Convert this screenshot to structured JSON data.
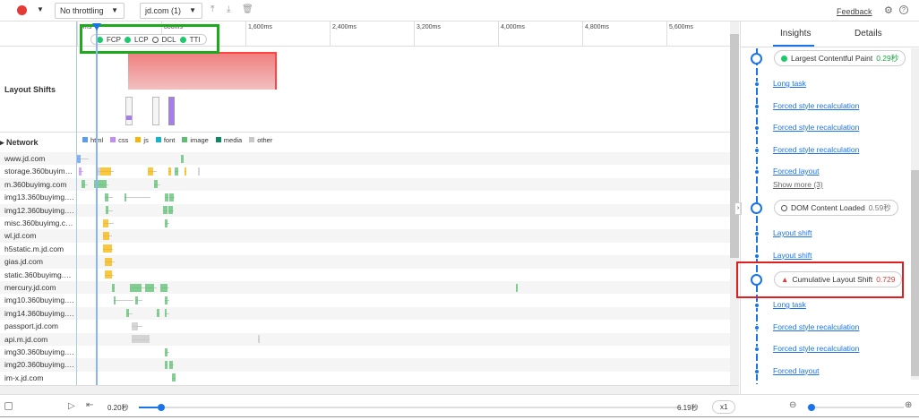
{
  "toolbar": {
    "throttling": "No throttling",
    "profile": "jd.com (1)",
    "feedback": "Feedback"
  },
  "ruler": {
    "ticks": [
      "0ms",
      "800ms",
      "1,600ms",
      "2,400ms",
      "3,200ms",
      "4,000ms",
      "4,800ms",
      "5,600ms"
    ]
  },
  "metrics_legend": [
    "FCP",
    "LCP",
    "DCL",
    "TTI"
  ],
  "layout_shifts": {
    "label": "Layout Shifts"
  },
  "network": {
    "label": "Network",
    "legend": [
      {
        "name": "html",
        "color": "#5b9cf0"
      },
      {
        "name": "css",
        "color": "#c58af9"
      },
      {
        "name": "js",
        "color": "#f7b500"
      },
      {
        "name": "font",
        "color": "#12b5cb"
      },
      {
        "name": "image",
        "color": "#5bbf6f"
      },
      {
        "name": "media",
        "color": "#0d8a5c"
      },
      {
        "name": "other",
        "color": "#c8c8c8"
      }
    ],
    "rows": [
      {
        "host": "www.jd.com",
        "segs": [
          [
            "html",
            0,
            30,
            110
          ],
          [
            "image",
            990,
            1010,
            1010
          ]
        ]
      },
      {
        "host": "storage.360buyimg.com",
        "segs": [
          [
            "css",
            20,
            40,
            60
          ],
          [
            "other",
            180,
            220,
            220
          ],
          [
            "js",
            220,
            320,
            350
          ],
          [
            "js",
            670,
            720,
            760
          ],
          [
            "js",
            870,
            890,
            890
          ],
          [
            "image",
            930,
            960,
            960
          ],
          [
            "js",
            1020,
            1040,
            1040
          ],
          [
            "other",
            1150,
            1160,
            1160
          ]
        ]
      },
      {
        "host": "m.360buyimg.com",
        "segs": [
          [
            "image",
            40,
            80,
            100
          ],
          [
            "image",
            160,
            280,
            300
          ],
          [
            "image",
            730,
            770,
            790
          ]
        ]
      },
      {
        "host": "img13.360buyimg.com",
        "segs": [
          [
            "image",
            260,
            300,
            340
          ],
          [
            "image",
            450,
            470,
            700
          ],
          [
            "image",
            830,
            870,
            870
          ],
          [
            "image",
            880,
            920,
            930
          ]
        ]
      },
      {
        "host": "img12.360buyimg.com",
        "segs": [
          [
            "image",
            270,
            300,
            340
          ],
          [
            "image",
            820,
            860,
            860
          ],
          [
            "image",
            870,
            910,
            920
          ]
        ]
      },
      {
        "host": "misc.360buyimg.com",
        "segs": [
          [
            "js",
            250,
            300,
            350
          ],
          [
            "image",
            830,
            860,
            880
          ]
        ]
      },
      {
        "host": "wl.jd.com",
        "segs": [
          [
            "js",
            250,
            310,
            330
          ]
        ]
      },
      {
        "host": "h5static.m.jd.com",
        "segs": [
          [
            "js",
            250,
            330,
            340
          ]
        ]
      },
      {
        "host": "gias.jd.com",
        "segs": [
          [
            "js",
            260,
            330,
            360
          ]
        ]
      },
      {
        "host": "static.360buyimg.com",
        "segs": [
          [
            "js",
            260,
            330,
            350
          ]
        ]
      },
      {
        "host": "mercury.jd.com",
        "segs": [
          [
            "image",
            330,
            360,
            360
          ],
          [
            "image",
            500,
            610,
            650
          ],
          [
            "image",
            650,
            730,
            760
          ],
          [
            "image",
            790,
            860,
            880
          ],
          [
            "image",
            4170,
            4185,
            4185
          ]
        ]
      },
      {
        "host": "img10.360buyimg.com",
        "segs": [
          [
            "image",
            350,
            370,
            540
          ],
          [
            "image",
            550,
            580,
            620
          ],
          [
            "image",
            830,
            860,
            880
          ]
        ]
      },
      {
        "host": "img14.360buyimg.com",
        "segs": [
          [
            "image",
            470,
            490,
            530
          ],
          [
            "image",
            760,
            780,
            780
          ],
          [
            "image",
            830,
            850,
            880
          ]
        ]
      },
      {
        "host": "passport.jd.com",
        "segs": [
          [
            "other",
            520,
            580,
            620
          ]
        ]
      },
      {
        "host": "api.m.jd.com",
        "segs": [
          [
            "other",
            520,
            690,
            690
          ],
          [
            "other",
            1720,
            1740,
            1740
          ]
        ]
      },
      {
        "host": "img30.360buyimg.com",
        "segs": [
          [
            "image",
            830,
            860,
            880
          ]
        ]
      },
      {
        "host": "img20.360buyimg.com",
        "segs": [
          [
            "image",
            830,
            860,
            860
          ],
          [
            "image",
            880,
            910,
            920
          ]
        ]
      },
      {
        "host": "im-x.jd.com",
        "segs": [
          [
            "image",
            900,
            940,
            940
          ]
        ]
      }
    ]
  },
  "insights": {
    "tabs": [
      "Insights",
      "Details"
    ],
    "lcp": {
      "label": "Largest Contentful Paint",
      "value": "0.29秒"
    },
    "group1": [
      "Long task",
      "Forced style recalculation",
      "Forced style recalculation",
      "Forced style recalculation",
      "Forced layout"
    ],
    "show_more": "Show more (3)",
    "dcl": {
      "label": "DOM Content Loaded",
      "value": "0.59秒"
    },
    "group2": [
      "Layout shift",
      "Layout shift"
    ],
    "cls": {
      "label": "Cumulative Layout Shift",
      "value": "0.729"
    },
    "group3": [
      "Long task",
      "Forced style recalculation",
      "Forced style recalculation",
      "Forced layout"
    ]
  },
  "playback": {
    "start": "0.20秒",
    "end": "6.19秒",
    "speed": "x1",
    "progress": 0.01,
    "zoom": 0.05
  },
  "colors": {
    "accent": "#1a73e8",
    "cls": "#e53935",
    "lcp": "#1ea446"
  }
}
